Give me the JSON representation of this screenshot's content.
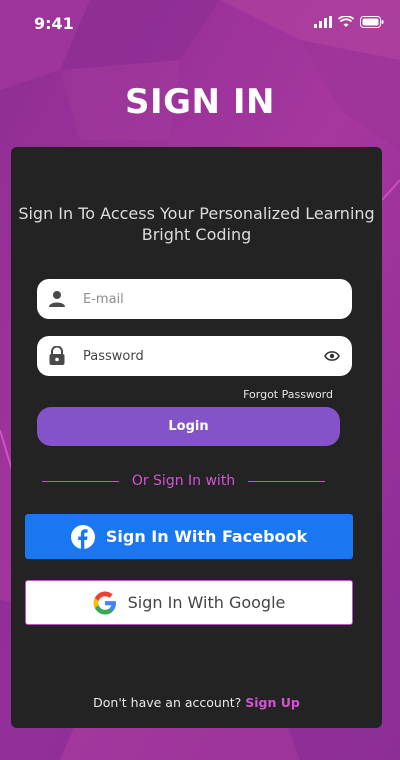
{
  "status_bar": {
    "time": "9:41"
  },
  "screen": {
    "title": "SIGN IN"
  },
  "card": {
    "subtitle": "Sign In To Access Your Personalized Learning Bright Coding",
    "email": {
      "placeholder": "E-mail",
      "value": ""
    },
    "password": {
      "placeholder": "Password",
      "value": ""
    },
    "forgot_label": "Forgot Password",
    "login_label": "Login",
    "divider_text": "Or Sign In with",
    "facebook_label": "Sign In With Facebook",
    "google_label": "Sign In With Google",
    "no_account_text": "Don't have an account?",
    "signup_label": "Sign Up"
  },
  "colors": {
    "background": "#9b2f9a",
    "card": "#232323",
    "accent": "#d453d6",
    "login_button": "#8553c9",
    "facebook": "#1a77f2"
  },
  "icons": [
    "person-icon",
    "lock-icon",
    "eye-icon",
    "facebook-icon",
    "google-icon",
    "signal-icon",
    "wifi-icon",
    "battery-icon"
  ]
}
